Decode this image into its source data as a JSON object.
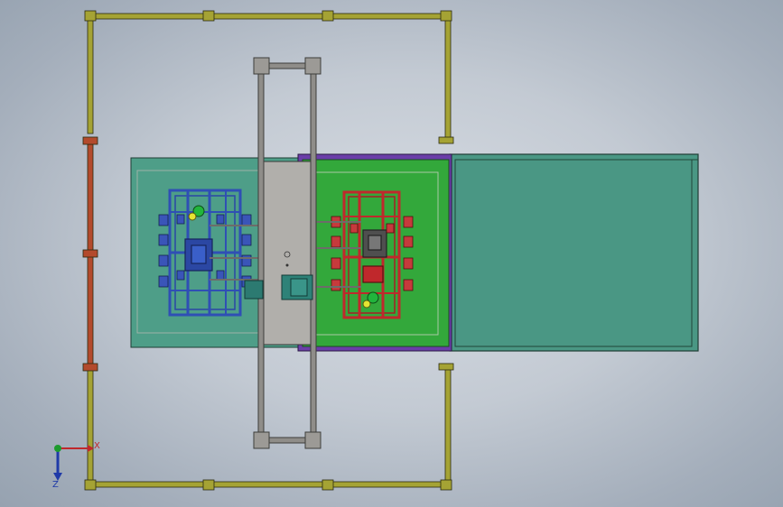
{
  "app": {
    "view": "Top",
    "display_style": "Shaded with edges"
  },
  "colors": {
    "fence_yellow": "#8f8e2e",
    "fence_red": "#b34a2c",
    "table_teal": "#4c9a87",
    "table_green": "#35a83a",
    "fixture_blue": "#2f4fb5",
    "fixture_red": "#c0282c",
    "gantry_gray": "#8e8c88",
    "purple_rail": "#7a3fb0",
    "axis_x": "#c0282c",
    "axis_y": "#1d9b2e",
    "axis_z": "#1f3aa8"
  },
  "triad": {
    "x_label": "X",
    "z_label": "Z"
  },
  "model": {
    "fence_brackets": 12,
    "blue_fixture_clamps": 10,
    "red_fixture_clamps": 10
  }
}
